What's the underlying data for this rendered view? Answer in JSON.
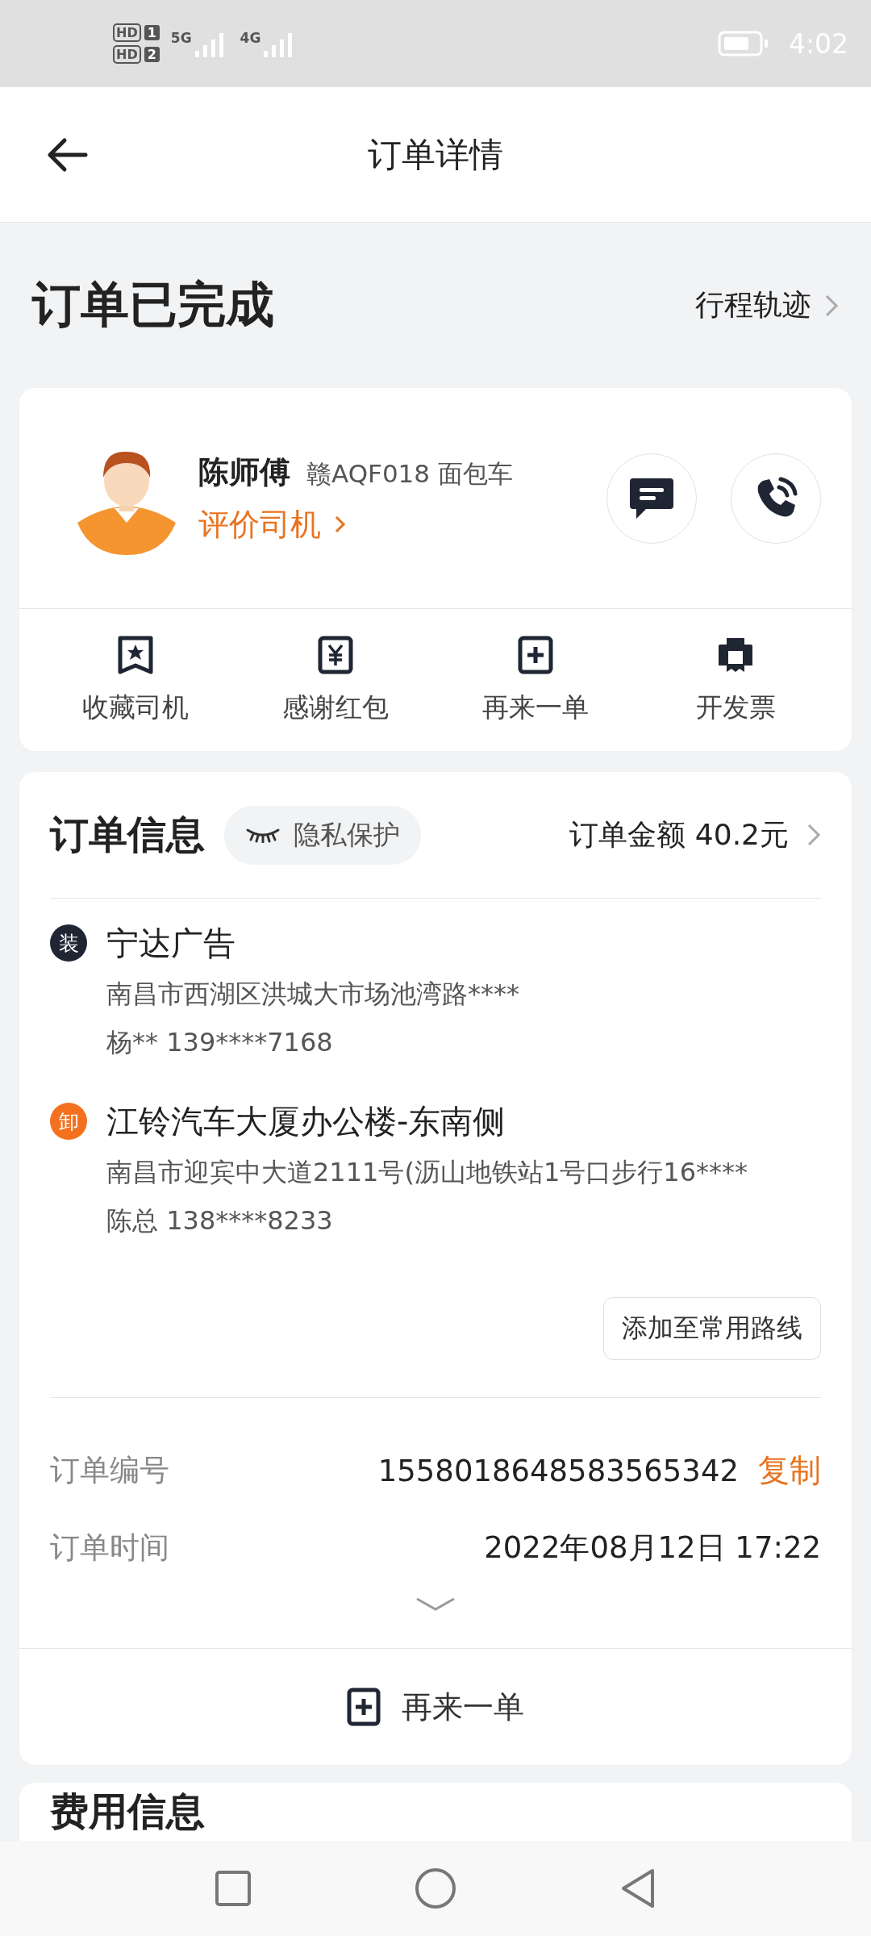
{
  "status_bar": {
    "sims": [
      {
        "label": "HD",
        "slot": "1"
      },
      {
        "label": "HD",
        "slot": "2"
      }
    ],
    "networks": [
      "5G",
      "4G"
    ],
    "time": "4:02"
  },
  "header": {
    "title": "订单详情"
  },
  "status": {
    "title": "订单已完成",
    "link": "行程轨迹"
  },
  "driver": {
    "name": "陈师傅",
    "vehicle": "赣AQF018 面包车",
    "rate_link": "评价司机"
  },
  "actions": [
    {
      "kind": "bookmark",
      "label": "收藏司机"
    },
    {
      "kind": "yen",
      "label": "感谢红包"
    },
    {
      "kind": "plus",
      "label": "再来一单"
    },
    {
      "kind": "printer",
      "label": "开发票"
    }
  ],
  "order_info": {
    "title": "订单信息",
    "privacy": "隐私保护",
    "amount": "订单金额 40.2元",
    "stops": [
      {
        "kind": "load",
        "badge": "装",
        "name": "宁达广告",
        "address": "南昌市西湖区洪城大市场池湾路****",
        "contact": "杨** 139****7168"
      },
      {
        "kind": "unload",
        "badge": "卸",
        "name": "江铃汽车大厦办公楼-东南侧",
        "address": "南昌市迎宾中大道2111号(沥山地铁站1号口步行16****",
        "contact": "陈总 138****8233"
      }
    ],
    "route_button": "添加至常用路线",
    "fields": [
      {
        "label": "订单编号",
        "value": "1558018648583565342",
        "action": "复制"
      },
      {
        "label": "订单时间",
        "value": "2022年08月12日 17:22"
      }
    ],
    "reorder_button": "再来一单"
  },
  "fee_info": {
    "title": "费用信息"
  }
}
